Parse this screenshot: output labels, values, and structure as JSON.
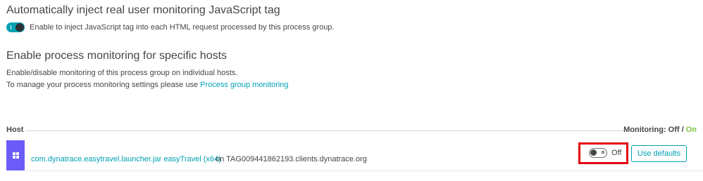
{
  "rum_section": {
    "title": "Automatically inject real user monitoring JavaScript tag",
    "toggle_label": "Enable to inject JavaScript tag into each HTML request processed by this process group.",
    "toggle_state": "on"
  },
  "host_section": {
    "title": "Enable process monitoring for specific hosts",
    "description_line1": "Enable/disable monitoring of this process group on individual hosts.",
    "description_line2_prefix": "To manage your process monitoring settings please use ",
    "description_link": "Process group monitoring"
  },
  "table": {
    "host_header": "Host",
    "monitoring_header_prefix": "Monitoring: ",
    "monitoring_off": "Off",
    "monitoring_sep": " / ",
    "monitoring_on": "On"
  },
  "host_row": {
    "icon": "windows-icon",
    "process_link": "com.dynatrace.easytravel.launcher.jar easyTravel (x64)",
    "host_text": "on TAG009441862193.clients.dynatrace.org",
    "toggle_state": "off",
    "toggle_label": "Off",
    "defaults_button": "Use defaults"
  },
  "colors": {
    "accent": "#00a1b2",
    "on_green": "#7dc540",
    "host_icon_bg": "#6c5bf6",
    "highlight_red": "#e3000f"
  }
}
